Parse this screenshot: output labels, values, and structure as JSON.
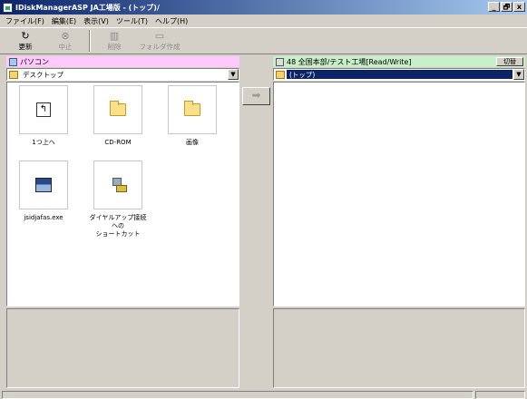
{
  "window": {
    "title": "IDiskManagerASP JA工場版 - (トップ)/",
    "controls": {
      "minimize": "_",
      "maximize": "🗗",
      "close": "x"
    }
  },
  "menu": [
    "ファイル(F)",
    "編集(E)",
    "表示(V)",
    "ツール(T)",
    "ヘルプ(H)"
  ],
  "toolbar": {
    "refresh": {
      "label": "更新",
      "icon": "refresh-icon"
    },
    "stop": {
      "label": "中止",
      "icon": "stop-icon"
    },
    "delete": {
      "label": "削除",
      "icon": "trash-icon"
    },
    "new_folder": {
      "label": "フォルダ作成",
      "icon": "new-folder-icon"
    }
  },
  "left_pane": {
    "header": "パソコン",
    "location": "デスクトップ",
    "items": [
      {
        "label": "1つ上へ",
        "icon": "up-icon"
      },
      {
        "label": "CD-ROM",
        "icon": "folder-icon"
      },
      {
        "label": "画像",
        "icon": "folder-icon"
      },
      {
        "label": "jsidjafas.exe",
        "icon": "exe-icon"
      },
      {
        "label": "ダイヤルアップ接続 への\nショートカット",
        "icon": "shortcut-icon"
      }
    ]
  },
  "transfer": {
    "arrow": "➡"
  },
  "right_pane": {
    "header": "48 全国本部/テスト工場[Read/Write]",
    "switch_label": "切替",
    "location": "(トップ)"
  },
  "colors": {
    "left_header_bg": "#ffc8ff",
    "right_header_bg": "#c8f0c8",
    "selection": "#0a246a"
  }
}
